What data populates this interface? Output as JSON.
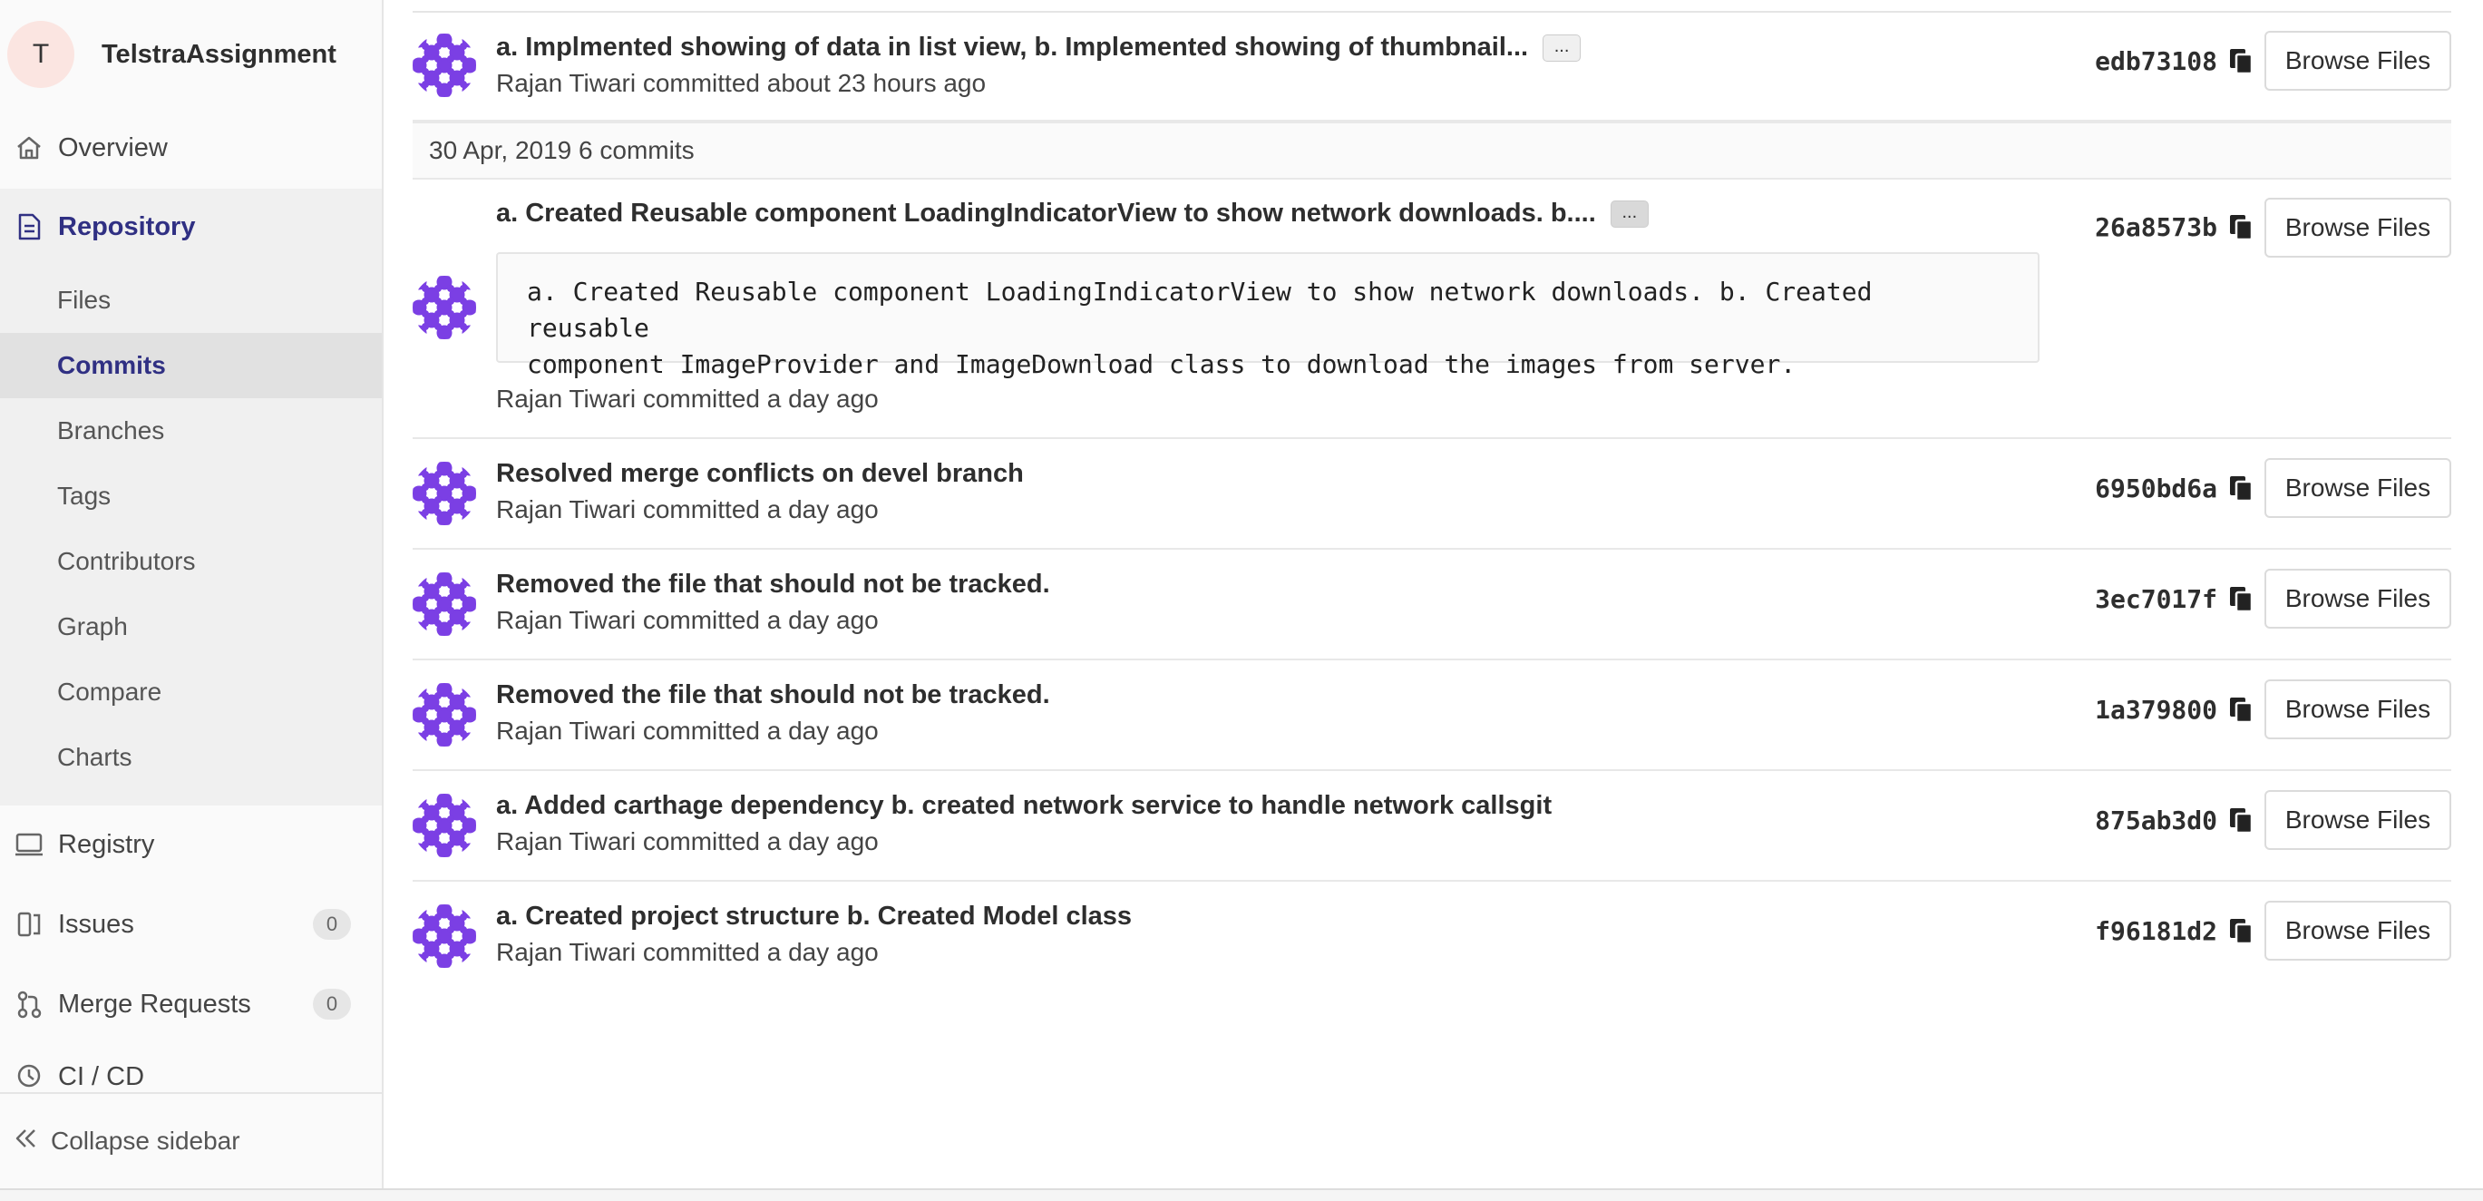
{
  "project": {
    "avatar_letter": "T",
    "name": "TelstraAssignment"
  },
  "nav": {
    "overview": "Overview",
    "repository": "Repository",
    "sub": [
      "Files",
      "Commits",
      "Branches",
      "Tags",
      "Contributors",
      "Graph",
      "Compare",
      "Charts"
    ],
    "registry": "Registry",
    "issues": {
      "label": "Issues",
      "count": "0"
    },
    "merge_requests": {
      "label": "Merge Requests",
      "count": "0"
    },
    "cicd": "CI / CD",
    "collapse": "Collapse sidebar"
  },
  "day_header": "30 Apr, 2019 6 commits",
  "browse_label": "Browse Files",
  "ellipsis": "...",
  "commits": [
    {
      "title": "a. Implmented showing of data in list view, b. Implemented showing of thumbnail...",
      "meta": "Rajan Tiwari committed about 23 hours ago",
      "sha": "edb73108"
    },
    {
      "title": "a. Created Reusable component LoadingIndicatorView to show network downloads. b....",
      "description": "a. Created Reusable component LoadingIndicatorView to show network downloads. b. Created reusable\ncomponent ImageProvider and ImageDownload class to download the images from server.",
      "meta": "Rajan Tiwari committed a day ago",
      "sha": "26a8573b"
    },
    {
      "title": "Resolved merge conflicts on devel branch",
      "meta": "Rajan Tiwari committed a day ago",
      "sha": "6950bd6a"
    },
    {
      "title": "Removed the file that should not be tracked.",
      "meta": "Rajan Tiwari committed a day ago",
      "sha": "3ec7017f"
    },
    {
      "title": "Removed the file that should not be tracked.",
      "meta": "Rajan Tiwari committed a day ago",
      "sha": "1a379800"
    },
    {
      "title": "a. Added carthage dependency b. created network service to handle network callsgit",
      "meta": "Rajan Tiwari committed a day ago",
      "sha": "875ab3d0"
    },
    {
      "title": "a. Created project structure b. Created Model class",
      "meta": "Rajan Tiwari committed a day ago",
      "sha": "f96181d2"
    }
  ],
  "colors": {
    "accent": "#303083",
    "avatar_purple": "#7b3fe4",
    "project_avatar_bg": "#fbe5e1"
  },
  "icons": [
    "home-icon",
    "doc-icon",
    "registry-icon",
    "issues-icon",
    "merge-request-icon",
    "cicd-icon",
    "collapse-icon",
    "copy-icon"
  ]
}
